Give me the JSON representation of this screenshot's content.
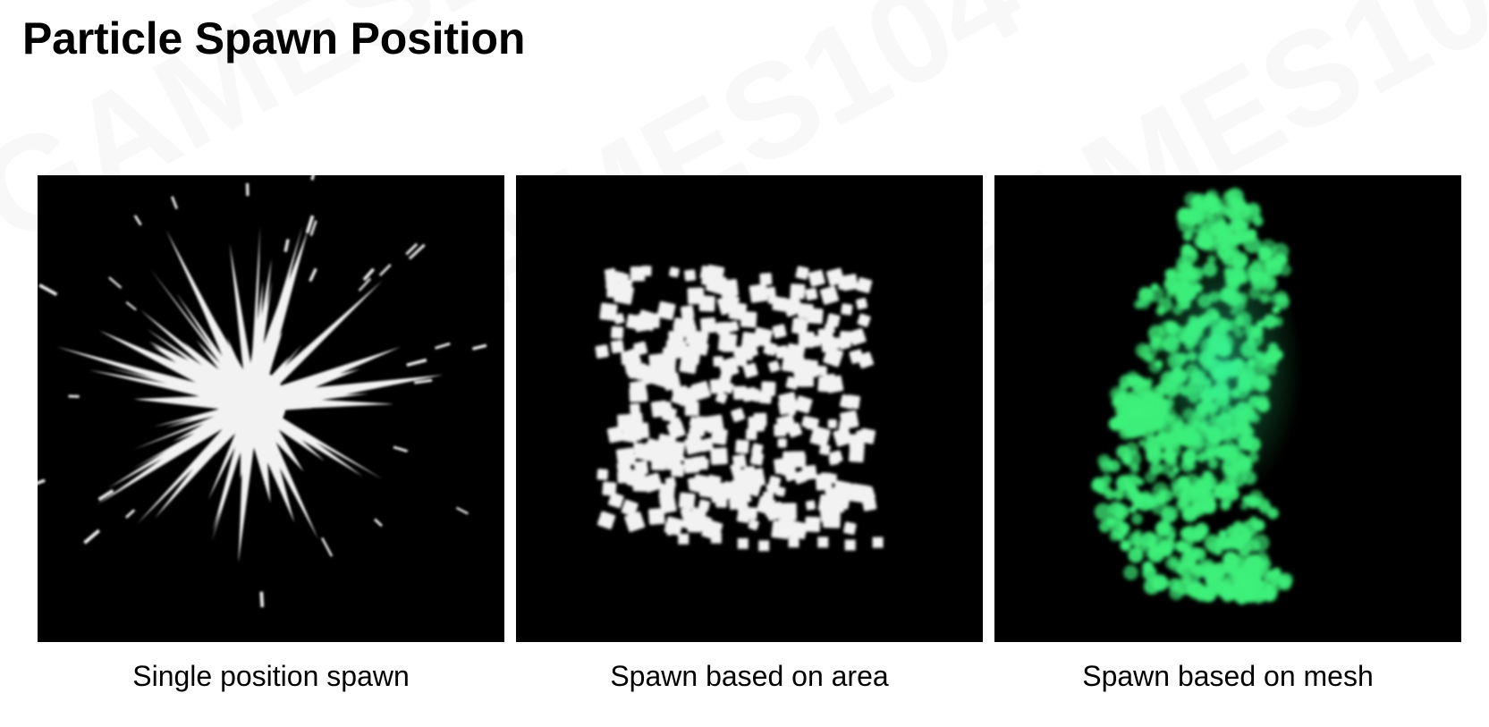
{
  "title": "Particle Spawn Position",
  "panels": [
    {
      "caption": "Single position spawn",
      "particle_color": "#f2f2f2",
      "icon": "burst-particles-image"
    },
    {
      "caption": "Spawn based on area",
      "particle_color": "#f2f2f2",
      "icon": "square-area-particles-image"
    },
    {
      "caption": "Spawn based on mesh",
      "particle_color": "#3ef07a",
      "icon": "mesh-particles-image"
    }
  ],
  "watermark": "GAMES104"
}
